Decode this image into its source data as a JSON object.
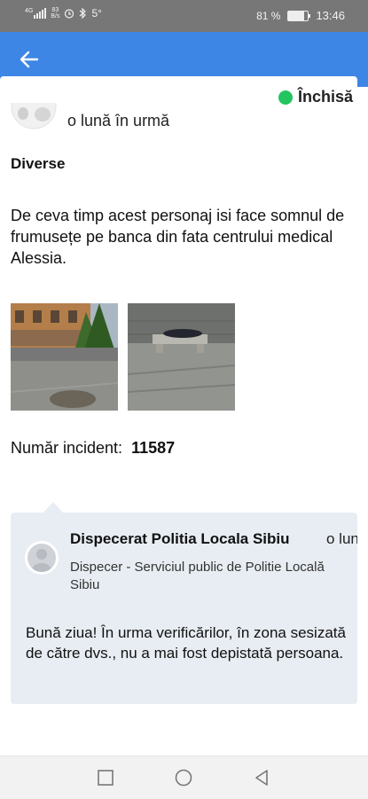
{
  "status_bar": {
    "network": "4G",
    "speed_top": "83",
    "speed_bottom": "B/s",
    "notification_count": "5°",
    "battery_percent": "81 %",
    "battery_level": 0.81,
    "time": "13:46"
  },
  "app_bar": {
    "color": "#3d86e6",
    "back_icon": "arrow-left-icon"
  },
  "report": {
    "time_ago": "o lună în urmă",
    "status": "Închisă",
    "status_color": "#22c55e",
    "category": "Diverse",
    "description": "De ceva timp acest personaj isi face somnul de frumusețe pe banca din fata centrului medical Alessia.",
    "incident_label": "Număr incident:",
    "incident_number": "11587"
  },
  "reply": {
    "author": "Dispecerat Politia Locala Sibiu",
    "time_ago": "o lun",
    "role": "Dispecer - Serviciul public de Politie Locală Sibiu",
    "message": "Bună  ziua! În urma verificărilor, în zona sesizată de către dvs., nu a mai fost depistată persoana."
  },
  "nav": {
    "icons": [
      "square-icon",
      "circle-icon",
      "triangle-back-icon"
    ]
  }
}
